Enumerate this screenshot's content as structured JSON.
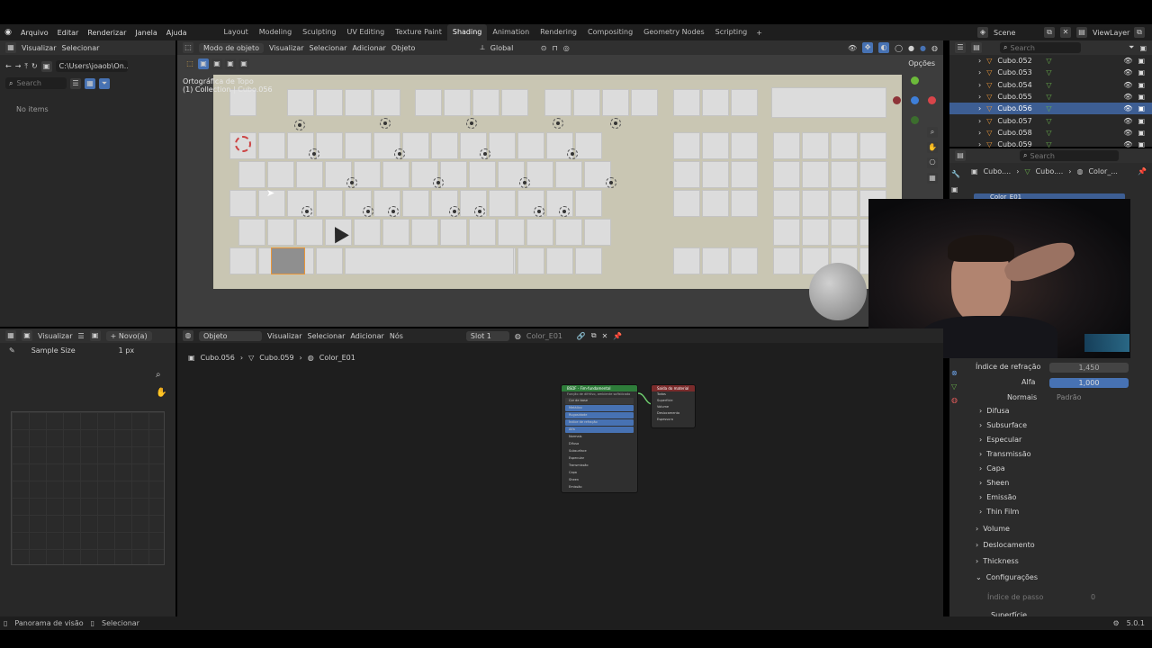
{
  "app": {
    "menus": [
      "Arquivo",
      "Editar",
      "Renderizar",
      "Janela",
      "Ajuda"
    ],
    "workspaces": [
      "Layout",
      "Modeling",
      "Sculpting",
      "UV Editing",
      "Texture Paint",
      "Shading",
      "Animation",
      "Rendering",
      "Compositing",
      "Geometry Nodes",
      "Scripting"
    ],
    "active_workspace": "Shading",
    "scene": "Scene",
    "view_layer": "ViewLayer"
  },
  "file_browser": {
    "menu": [
      "Visualizar",
      "Selecionar"
    ],
    "path": "C:\\Users\\joaob\\On...",
    "search_placeholder": "Search",
    "empty": "No items"
  },
  "viewport": {
    "mode": "Modo de objeto",
    "menu": [
      "Visualizar",
      "Selecionar",
      "Adicionar",
      "Objeto"
    ],
    "orientation": "Global",
    "options": "Opções",
    "view_name": "Ortográfica de Topo",
    "collection_info": "(1) Collection | Cubo.056"
  },
  "outliner": {
    "search_placeholder": "Search",
    "items": [
      "Cubo.052",
      "Cubo.053",
      "Cubo.054",
      "Cubo.055",
      "Cubo.056",
      "Cubo.057",
      "Cubo.058",
      "Cubo.059"
    ],
    "selected": "Cubo.056"
  },
  "properties": {
    "search_placeholder": "Search",
    "breadcrumb": [
      "Cubo....",
      "Cubo....",
      "Color_..."
    ],
    "material_slot": "Color_E01",
    "fields": [
      {
        "label": "Índice de refração",
        "value": "1,450"
      },
      {
        "label": "Alfa",
        "value": "1,000"
      },
      {
        "label": "Normais",
        "value": "Padrão"
      }
    ],
    "sections": [
      "Difusa",
      "Subsurface",
      "Especular",
      "Transmissão",
      "Capa",
      "Sheen",
      "Emissão",
      "Thin Film"
    ],
    "groups": [
      "Volume",
      "Deslocamento",
      "Thickness",
      "Configurações"
    ],
    "sub_field": {
      "label": "Índice de passo",
      "value": "0"
    },
    "sub_section": "Superfície"
  },
  "image_editor": {
    "menu": "Visualizar",
    "new_button": "Novo(a)",
    "sample_label": "Sample Size",
    "sample_value": "1 px"
  },
  "node_editor": {
    "type": "Objeto",
    "menu": [
      "Visualizar",
      "Selecionar",
      "Adicionar",
      "Nós"
    ],
    "slot": "Slot 1",
    "material": "Color_E01",
    "breadcrumb": [
      "Cubo.056",
      "Cubo.059",
      "Color_E01"
    ],
    "bsdf_node": {
      "title": "BSDF - Fim-fundamental",
      "subtitle": "Função de difrtívo, ambiente sofisticado",
      "rows": [
        "Cor de base",
        "Metálico",
        "Rugosidade",
        "Índice de refração",
        "Alfa",
        "Normais",
        "Difusa",
        "Subsurface",
        "Especular",
        "Transmissão",
        "Capa",
        "Sheen",
        "Emissão",
        "Thin film"
      ]
    },
    "output_node": {
      "title": "Saída do material",
      "rows": [
        "Todos",
        "Superfície",
        "Volume",
        "Deslocamento",
        "Espessura"
      ]
    }
  },
  "status": {
    "left": "Panorama de visão",
    "right": "Selecionar",
    "version": "5.0.1"
  },
  "colors": {
    "accent": "#4772b3",
    "selected_row": "#3d5e93",
    "bsdf_header": "#2e7d3a",
    "output_header": "#7a2b2b",
    "selection_outline": "#e8963a"
  }
}
